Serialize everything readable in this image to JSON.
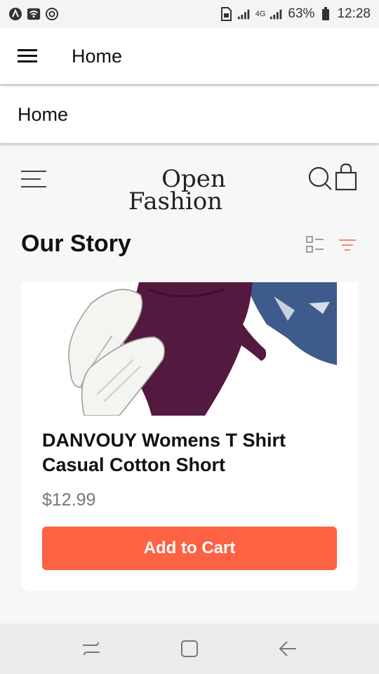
{
  "statusbar": {
    "battery": "63%",
    "time": "12:28",
    "network": "4G",
    "icons": [
      "app-icon",
      "wifi-icon",
      "sync-icon",
      "sim-icon",
      "signal-icon",
      "battery-icon"
    ]
  },
  "appbar": {
    "title": "Home"
  },
  "subbar": {
    "title": "Home"
  },
  "shop": {
    "logo_line1": "Open",
    "logo_line2": "Fashion",
    "section_title": "Our Story"
  },
  "product": {
    "title": "DANVOUY Womens T Shirt Casual Cotton Short",
    "price": "$12.99",
    "add_to_cart_label": "Add to Cart"
  },
  "colors": {
    "accent": "#fd6243",
    "filter": "#f08a5d",
    "background": "#f7f7f7",
    "card": "#ffffff"
  }
}
